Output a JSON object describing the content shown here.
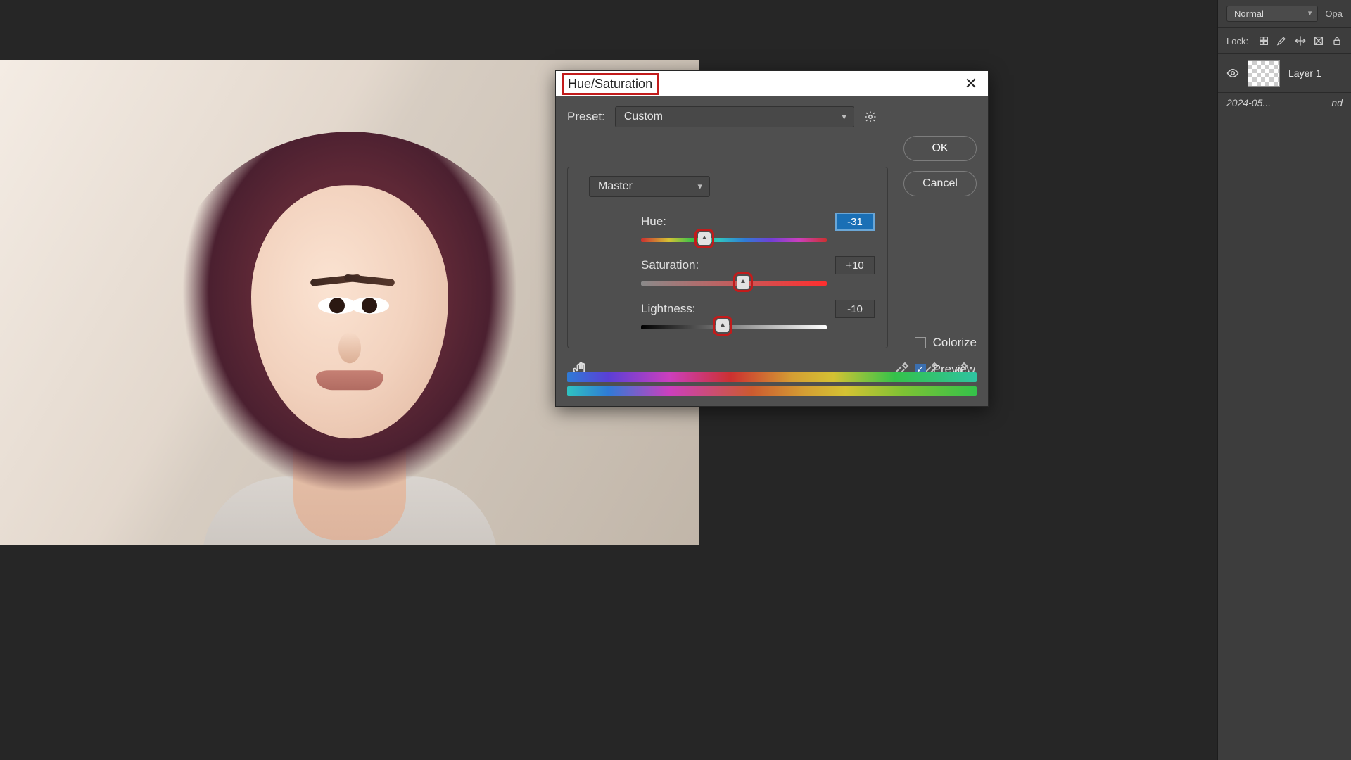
{
  "right_panel": {
    "blend_mode": "Normal",
    "opacity_label": "Opa",
    "lock_label": "Lock:",
    "layers": [
      {
        "name": "Layer 1"
      }
    ],
    "sub_line": "2024-05...",
    "sub_suffix": "nd"
  },
  "dialog": {
    "title": "Hue/Saturation",
    "preset_label": "Preset:",
    "preset_value": "Custom",
    "channel_value": "Master",
    "ok": "OK",
    "cancel": "Cancel",
    "hue_label": "Hue:",
    "hue_value": "-31",
    "hue_pos_pct": 34,
    "sat_label": "Saturation:",
    "sat_value": "+10",
    "sat_pos_pct": 55,
    "lig_label": "Lightness:",
    "lig_value": "-10",
    "lig_pos_pct": 44,
    "colorize_label": "Colorize",
    "colorize_checked": false,
    "preview_label": "Preview",
    "preview_checked": true
  }
}
